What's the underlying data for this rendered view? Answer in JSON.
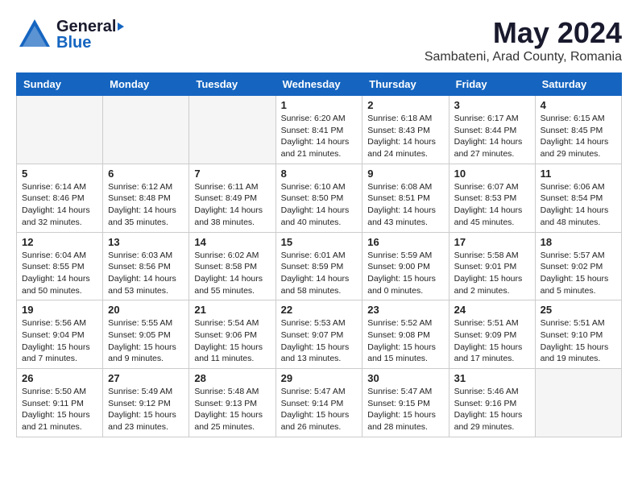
{
  "header": {
    "logo_general": "General",
    "logo_blue": "Blue",
    "month_title": "May 2024",
    "location": "Sambateni, Arad County, Romania"
  },
  "calendar": {
    "days_of_week": [
      "Sunday",
      "Monday",
      "Tuesday",
      "Wednesday",
      "Thursday",
      "Friday",
      "Saturday"
    ],
    "weeks": [
      [
        {
          "day": "",
          "info": ""
        },
        {
          "day": "",
          "info": ""
        },
        {
          "day": "",
          "info": ""
        },
        {
          "day": "1",
          "info": "Sunrise: 6:20 AM\nSunset: 8:41 PM\nDaylight: 14 hours\nand 21 minutes."
        },
        {
          "day": "2",
          "info": "Sunrise: 6:18 AM\nSunset: 8:43 PM\nDaylight: 14 hours\nand 24 minutes."
        },
        {
          "day": "3",
          "info": "Sunrise: 6:17 AM\nSunset: 8:44 PM\nDaylight: 14 hours\nand 27 minutes."
        },
        {
          "day": "4",
          "info": "Sunrise: 6:15 AM\nSunset: 8:45 PM\nDaylight: 14 hours\nand 29 minutes."
        }
      ],
      [
        {
          "day": "5",
          "info": "Sunrise: 6:14 AM\nSunset: 8:46 PM\nDaylight: 14 hours\nand 32 minutes."
        },
        {
          "day": "6",
          "info": "Sunrise: 6:12 AM\nSunset: 8:48 PM\nDaylight: 14 hours\nand 35 minutes."
        },
        {
          "day": "7",
          "info": "Sunrise: 6:11 AM\nSunset: 8:49 PM\nDaylight: 14 hours\nand 38 minutes."
        },
        {
          "day": "8",
          "info": "Sunrise: 6:10 AM\nSunset: 8:50 PM\nDaylight: 14 hours\nand 40 minutes."
        },
        {
          "day": "9",
          "info": "Sunrise: 6:08 AM\nSunset: 8:51 PM\nDaylight: 14 hours\nand 43 minutes."
        },
        {
          "day": "10",
          "info": "Sunrise: 6:07 AM\nSunset: 8:53 PM\nDaylight: 14 hours\nand 45 minutes."
        },
        {
          "day": "11",
          "info": "Sunrise: 6:06 AM\nSunset: 8:54 PM\nDaylight: 14 hours\nand 48 minutes."
        }
      ],
      [
        {
          "day": "12",
          "info": "Sunrise: 6:04 AM\nSunset: 8:55 PM\nDaylight: 14 hours\nand 50 minutes."
        },
        {
          "day": "13",
          "info": "Sunrise: 6:03 AM\nSunset: 8:56 PM\nDaylight: 14 hours\nand 53 minutes."
        },
        {
          "day": "14",
          "info": "Sunrise: 6:02 AM\nSunset: 8:58 PM\nDaylight: 14 hours\nand 55 minutes."
        },
        {
          "day": "15",
          "info": "Sunrise: 6:01 AM\nSunset: 8:59 PM\nDaylight: 14 hours\nand 58 minutes."
        },
        {
          "day": "16",
          "info": "Sunrise: 5:59 AM\nSunset: 9:00 PM\nDaylight: 15 hours\nand 0 minutes."
        },
        {
          "day": "17",
          "info": "Sunrise: 5:58 AM\nSunset: 9:01 PM\nDaylight: 15 hours\nand 2 minutes."
        },
        {
          "day": "18",
          "info": "Sunrise: 5:57 AM\nSunset: 9:02 PM\nDaylight: 15 hours\nand 5 minutes."
        }
      ],
      [
        {
          "day": "19",
          "info": "Sunrise: 5:56 AM\nSunset: 9:04 PM\nDaylight: 15 hours\nand 7 minutes."
        },
        {
          "day": "20",
          "info": "Sunrise: 5:55 AM\nSunset: 9:05 PM\nDaylight: 15 hours\nand 9 minutes."
        },
        {
          "day": "21",
          "info": "Sunrise: 5:54 AM\nSunset: 9:06 PM\nDaylight: 15 hours\nand 11 minutes."
        },
        {
          "day": "22",
          "info": "Sunrise: 5:53 AM\nSunset: 9:07 PM\nDaylight: 15 hours\nand 13 minutes."
        },
        {
          "day": "23",
          "info": "Sunrise: 5:52 AM\nSunset: 9:08 PM\nDaylight: 15 hours\nand 15 minutes."
        },
        {
          "day": "24",
          "info": "Sunrise: 5:51 AM\nSunset: 9:09 PM\nDaylight: 15 hours\nand 17 minutes."
        },
        {
          "day": "25",
          "info": "Sunrise: 5:51 AM\nSunset: 9:10 PM\nDaylight: 15 hours\nand 19 minutes."
        }
      ],
      [
        {
          "day": "26",
          "info": "Sunrise: 5:50 AM\nSunset: 9:11 PM\nDaylight: 15 hours\nand 21 minutes."
        },
        {
          "day": "27",
          "info": "Sunrise: 5:49 AM\nSunset: 9:12 PM\nDaylight: 15 hours\nand 23 minutes."
        },
        {
          "day": "28",
          "info": "Sunrise: 5:48 AM\nSunset: 9:13 PM\nDaylight: 15 hours\nand 25 minutes."
        },
        {
          "day": "29",
          "info": "Sunrise: 5:47 AM\nSunset: 9:14 PM\nDaylight: 15 hours\nand 26 minutes."
        },
        {
          "day": "30",
          "info": "Sunrise: 5:47 AM\nSunset: 9:15 PM\nDaylight: 15 hours\nand 28 minutes."
        },
        {
          "day": "31",
          "info": "Sunrise: 5:46 AM\nSunset: 9:16 PM\nDaylight: 15 hours\nand 29 minutes."
        },
        {
          "day": "",
          "info": ""
        }
      ]
    ]
  }
}
